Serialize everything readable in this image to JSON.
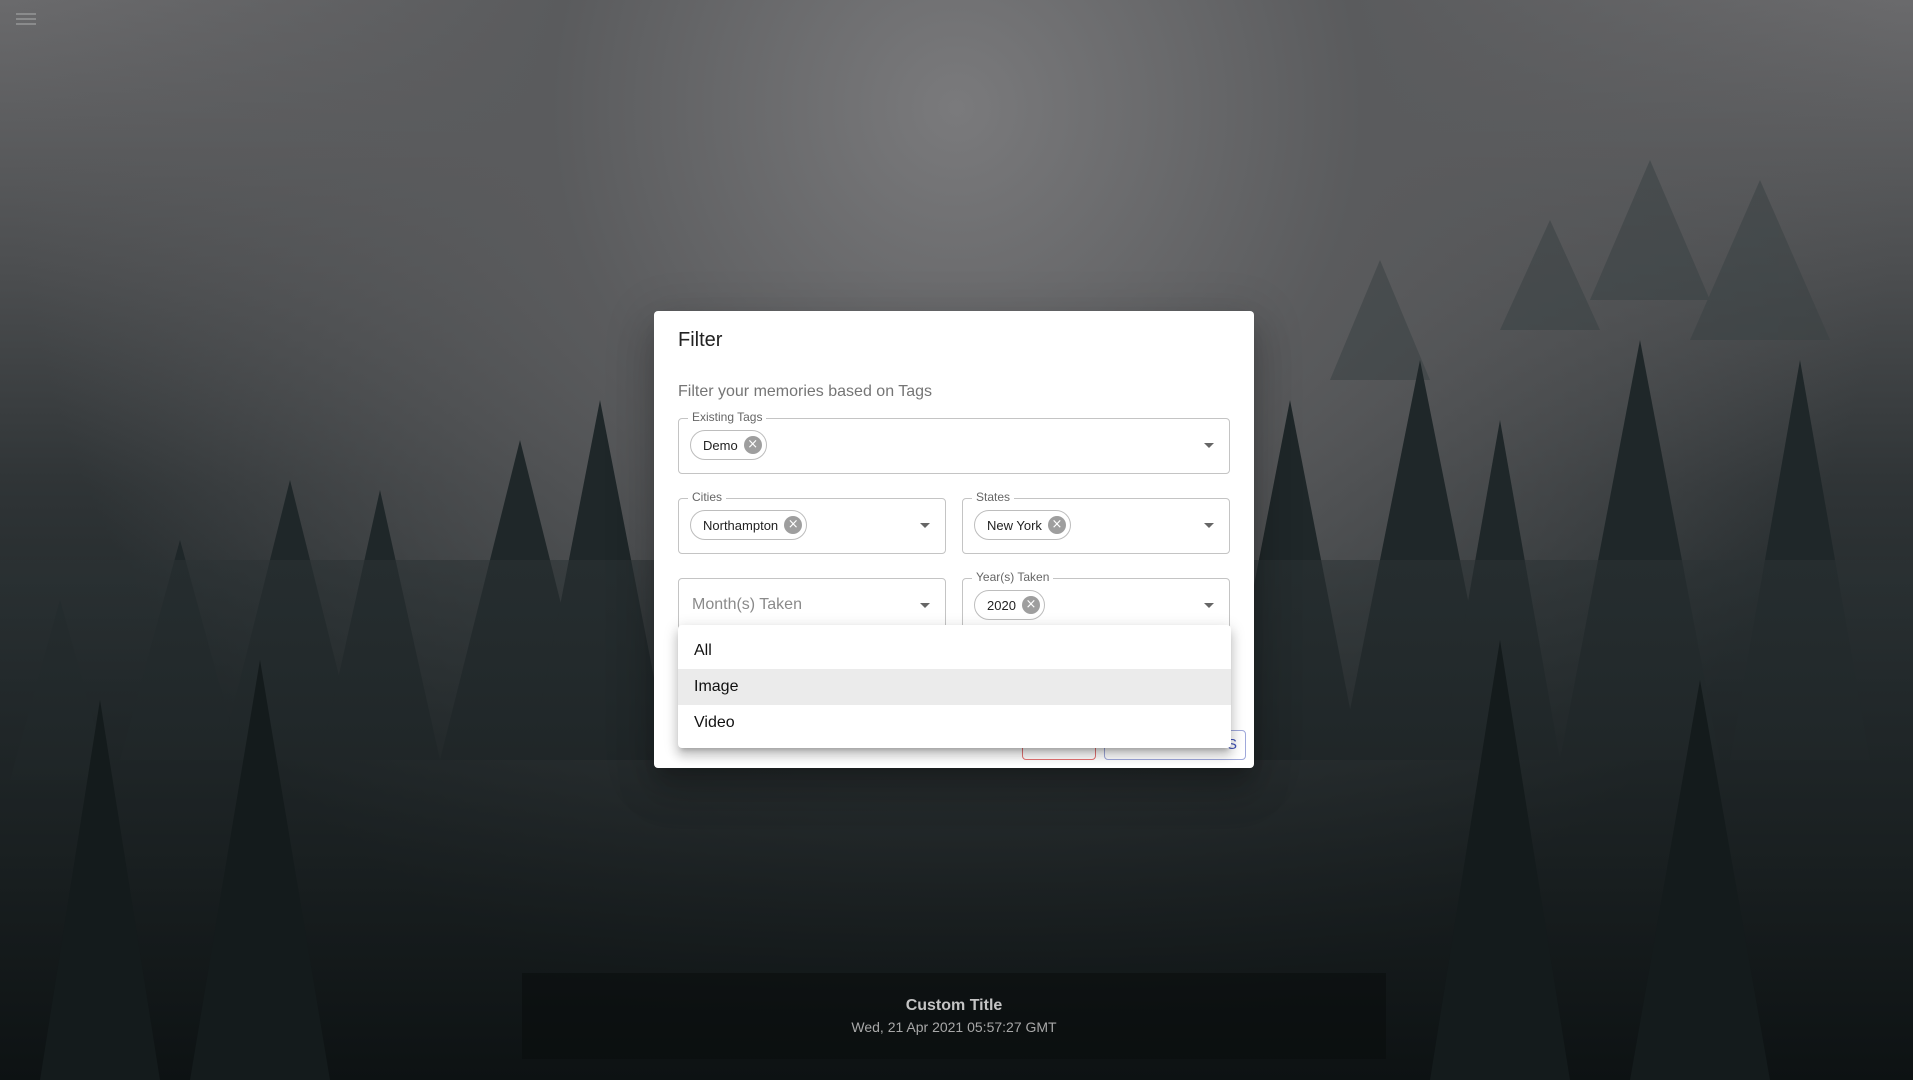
{
  "dialog": {
    "title": "Filter",
    "description": "Filter your memories based on Tags",
    "fields": {
      "tags": {
        "label": "Existing Tags",
        "chips": [
          "Demo"
        ]
      },
      "cities": {
        "label": "Cities",
        "chips": [
          "Northampton"
        ]
      },
      "states": {
        "label": "States",
        "chips": [
          "New York"
        ]
      },
      "months": {
        "placeholder": "Month(s) Taken"
      },
      "years": {
        "label": "Year(s) Taken",
        "chips": [
          "2020"
        ]
      }
    },
    "apply_button_visible": "S"
  },
  "dropdown": {
    "options": [
      "All",
      "Image",
      "Video"
    ],
    "highlighted": "Image"
  },
  "caption": {
    "title": "Custom Title",
    "date": "Wed, 21 Apr 2021 05:57:27 GMT"
  },
  "colors": {
    "accent": "#3f51b5",
    "cancel": "#e57373",
    "overlay": "#2a3032"
  },
  "icons": {
    "menu": "hamburger-menu-icon",
    "chip_remove": "cancel-circle-icon",
    "dropdown": "arrow-drop-down-icon"
  }
}
